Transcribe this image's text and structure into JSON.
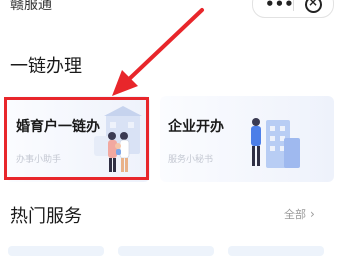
{
  "header": {
    "app_title": "赣服通"
  },
  "section1": {
    "title": "一链办理"
  },
  "cards": [
    {
      "title": "婚育户一链办",
      "subtitle": "办事小助手"
    },
    {
      "title": "企业开办",
      "subtitle": "服务小秘书"
    }
  ],
  "section2": {
    "title": "热门服务",
    "more": "全部"
  },
  "colors": {
    "annotation_red": "#e8262b",
    "card_gradient_end": "#eef2fb"
  }
}
